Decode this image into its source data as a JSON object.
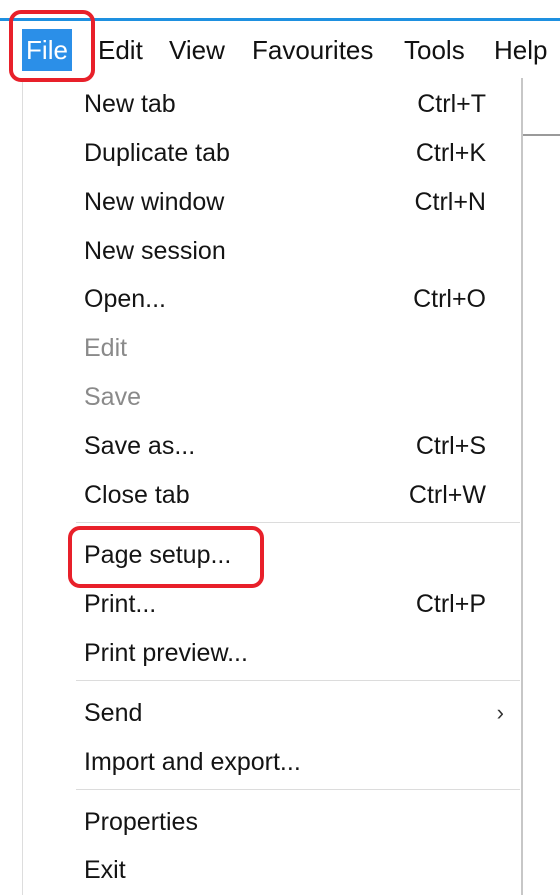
{
  "menubar": {
    "items": [
      {
        "label": "File",
        "active": true
      },
      {
        "label": "Edit"
      },
      {
        "label": "View"
      },
      {
        "label": "Favourites"
      },
      {
        "label": "Tools"
      },
      {
        "label": "Help"
      }
    ]
  },
  "file_menu": {
    "items": [
      {
        "label": "New tab",
        "shortcut": "Ctrl+T"
      },
      {
        "label": "Duplicate tab",
        "shortcut": "Ctrl+K"
      },
      {
        "label": "New window",
        "shortcut": "Ctrl+N"
      },
      {
        "label": "New session",
        "shortcut": ""
      },
      {
        "label": "Open...",
        "shortcut": "Ctrl+O"
      },
      {
        "label": "Edit",
        "shortcut": "",
        "disabled": true
      },
      {
        "label": "Save",
        "shortcut": "",
        "disabled": true
      },
      {
        "label": "Save as...",
        "shortcut": "Ctrl+S"
      },
      {
        "label": "Close tab",
        "shortcut": "Ctrl+W"
      },
      {
        "label": "Page setup...",
        "shortcut": ""
      },
      {
        "label": "Print...",
        "shortcut": "Ctrl+P"
      },
      {
        "label": "Print preview...",
        "shortcut": ""
      },
      {
        "label": "Send",
        "shortcut": "",
        "submenu_arrow": "›"
      },
      {
        "label": "Import and export...",
        "shortcut": ""
      },
      {
        "label": "Properties",
        "shortcut": ""
      },
      {
        "label": "Exit",
        "shortcut": ""
      }
    ]
  },
  "colors": {
    "active_menu_bg": "#2b8fe8",
    "highlight_border": "#e8202a",
    "disabled_text": "#8a8a8a",
    "frame_blue": "#1e90e0"
  }
}
